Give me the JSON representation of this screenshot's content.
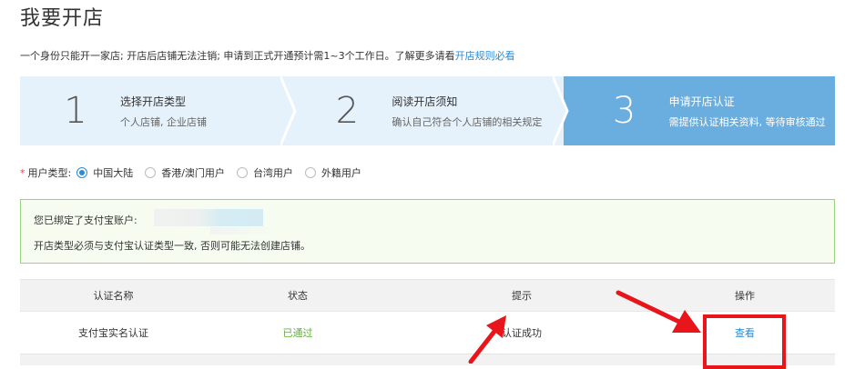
{
  "page": {
    "title": "我要开店",
    "notice_text": "一个身份只能开一家店; 开店后店铺无法注销; 申请到正式开通预计需1~3个工作日。了解更多请看",
    "notice_link": "开店规则必看"
  },
  "steps": [
    {
      "number": "1",
      "title": "选择开店类型",
      "desc": "个人店铺, 企业店铺",
      "active": false
    },
    {
      "number": "2",
      "title": "阅读开店须知",
      "desc": "确认自己符合个人店铺的相关规定",
      "active": false
    },
    {
      "number": "3",
      "title": "申请开店认证",
      "desc": "需提供认证相关资料, 等待审核通过",
      "active": true
    }
  ],
  "user_type": {
    "required_mark": "*",
    "label": "用户类型:",
    "options": [
      "中国大陆",
      "香港/澳门用户",
      "台湾用户",
      "外籍用户"
    ],
    "selected": "中国大陆"
  },
  "info_box": {
    "line1": "您已绑定了支付宝账户:",
    "line2": "开店类型必须与支付宝认证类型一致, 否则可能无法创建店铺。"
  },
  "table": {
    "headers": [
      "认证名称",
      "状态",
      "提示",
      "操作"
    ],
    "rows": [
      {
        "name": "支付宝实名认证",
        "status": "已通过",
        "hint": "认证成功",
        "action": "查看"
      }
    ]
  },
  "colors": {
    "accent": "#2a8bd6",
    "step_active": "#6aaedf",
    "step_inactive": "#e5f1fb",
    "success": "#5fb336",
    "annotation": "#e8151b"
  }
}
